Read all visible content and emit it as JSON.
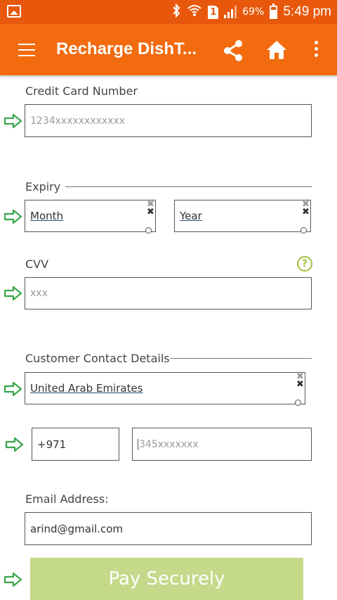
{
  "status_bar": {
    "battery_percent": "69%",
    "time": "5:49 pm",
    "sim_slot": "1"
  },
  "app_bar": {
    "title": "Recharge DishT...",
    "menu_icon": "hamburger-icon",
    "share_icon": "share-icon",
    "home_icon": "home-icon",
    "more_icon": "more-vert-icon"
  },
  "form": {
    "credit_card": {
      "label": "Credit Card Number",
      "placeholder": "1234xxxxxxxxxxxx"
    },
    "expiry": {
      "label": "Expiry",
      "month": "Month",
      "year": "Year"
    },
    "cvv": {
      "label": "CVV",
      "placeholder": "xxx",
      "help_icon": "?"
    },
    "contact": {
      "label": "Customer Contact Details",
      "country": "United Arab Emirates",
      "dial_code": "+971",
      "phone_placeholder": "345xxxxxxx"
    },
    "email": {
      "label": "Email Address:",
      "value": "arind@gmail.com"
    },
    "pay_button": "Pay Securely"
  },
  "colors": {
    "status_bar": "#e8580c",
    "app_bar": "#f26b0f",
    "arrow_green": "#3aa64a",
    "help_green": "#a3c23d",
    "pay_button_bg": "#c5d98b"
  }
}
